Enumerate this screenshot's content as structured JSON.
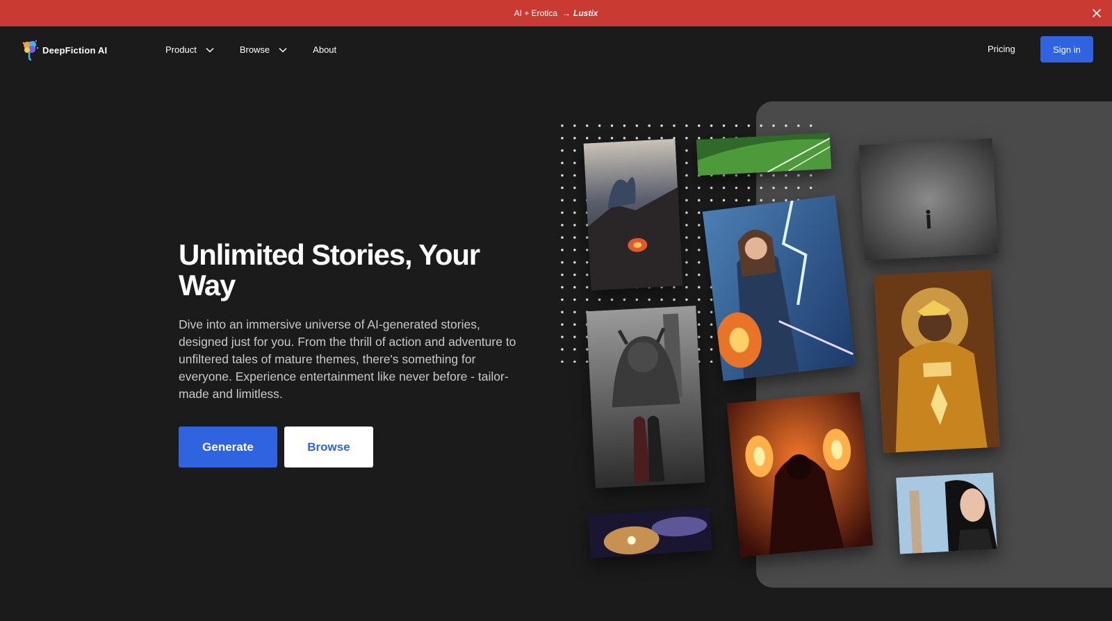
{
  "announcement": {
    "text": "AI + Erotica",
    "arrow": "→",
    "brand": "Lustix"
  },
  "nav": {
    "logo_text": "DeepFiction AI",
    "links": [
      {
        "label": "Product",
        "has_dropdown": true
      },
      {
        "label": "Browse",
        "has_dropdown": true
      },
      {
        "label": "About",
        "has_dropdown": false
      }
    ],
    "pricing_label": "Pricing",
    "signin_label": "Sign in"
  },
  "hero": {
    "title": "Unlimited Stories, Your Way",
    "description": "Dive into an immersive universe of AI-generated stories, designed just for you. From the thrill of action and adventure to unfiltered tales of mature themes, there's something for everyone. Experience entertainment like never before - tailor-made and limitless.",
    "primary_button": "Generate",
    "secondary_button": "Browse"
  },
  "gallery": {
    "images": [
      "dragon-on-cliff",
      "green-field",
      "foggy-forest-figure",
      "sorceress-lightning",
      "demon-lord-couple",
      "golden-goddess",
      "fire-mage-torches",
      "galaxy-nebula",
      "dark-haired-woman-city"
    ]
  },
  "colors": {
    "announcement_bg": "#c93a33",
    "page_bg": "#1b1b1c",
    "accent": "#2f63e0",
    "panel": "#4a4a4b"
  }
}
